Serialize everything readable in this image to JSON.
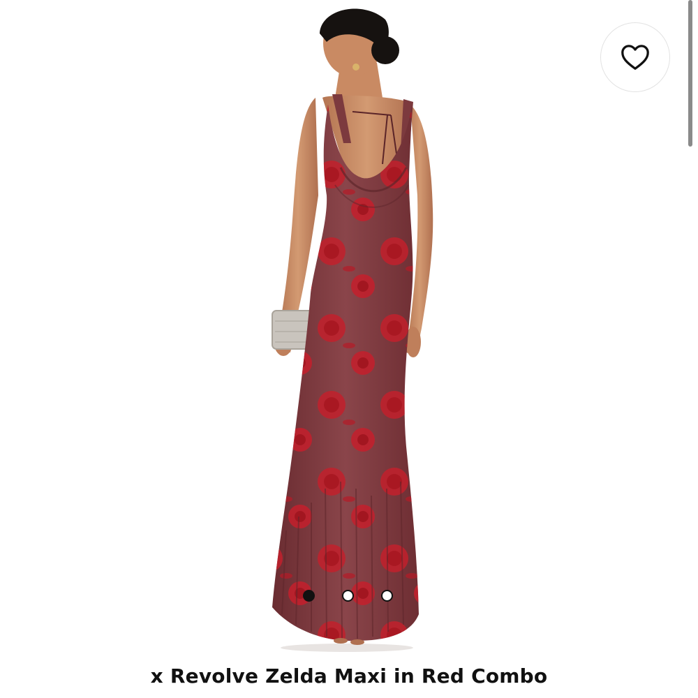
{
  "product": {
    "title": "x Revolve Zelda Maxi in Red Combo",
    "image": {
      "alt": "Model wearing red floral cowl-back maxi dress, back view, holding a silver clutch",
      "background": "#ffffff",
      "dress_base_color": "#7c3a3e",
      "rose_color": "#c2202c",
      "skin_color": "#c98a63",
      "hair_color": "#161210",
      "clutch_color": "#c9c4bd"
    }
  },
  "favorite": {
    "icon": "heart-outline-icon",
    "state": "not-favorited"
  },
  "carousel": {
    "total": 3,
    "active_index": 0
  }
}
